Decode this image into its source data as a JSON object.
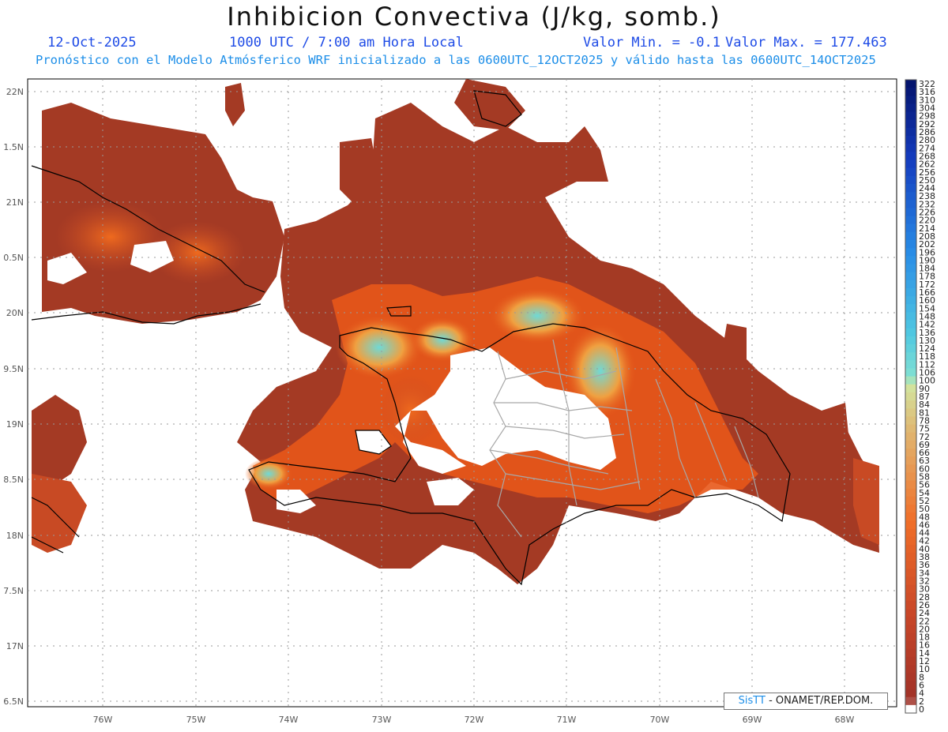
{
  "header": {
    "title": "Inhibicion Convectiva (J/kg, somb.)",
    "date": "12-Oct-2025",
    "time": "1000 UTC / 7:00 am Hora Local",
    "valor_min": "Valor Min. = -0.1",
    "valor_max": "Valor Max. = 177.463",
    "subtitle": "Pronóstico con el Modelo Atmósferico WRF inicializado a las 0600UTC_12OCT2025 y válido hasta las  0600UTC_14OCT2025"
  },
  "axes": {
    "lat_labels": [
      "22N",
      "1.5N",
      "21N",
      "0.5N",
      "20N",
      "9.5N",
      "19N",
      "8.5N",
      "18N",
      "7.5N",
      "17N",
      "6.5N"
    ],
    "lon_labels": [
      "76W",
      "75W",
      "74W",
      "73W",
      "72W",
      "71W",
      "70W",
      "69W",
      "68W"
    ]
  },
  "colorbar": {
    "labels": [
      "322",
      "316",
      "310",
      "304",
      "298",
      "292",
      "286",
      "280",
      "274",
      "268",
      "262",
      "256",
      "250",
      "244",
      "238",
      "232",
      "226",
      "220",
      "214",
      "208",
      "202",
      "196",
      "190",
      "184",
      "178",
      "172",
      "166",
      "160",
      "154",
      "148",
      "142",
      "136",
      "130",
      "124",
      "118",
      "112",
      "106",
      "100",
      "90",
      "87",
      "84",
      "81",
      "78",
      "75",
      "72",
      "69",
      "66",
      "63",
      "60",
      "58",
      "56",
      "54",
      "52",
      "50",
      "48",
      "46",
      "44",
      "42",
      "40",
      "38",
      "36",
      "34",
      "32",
      "30",
      "28",
      "26",
      "24",
      "22",
      "20",
      "18",
      "16",
      "14",
      "12",
      "10",
      "8",
      "6",
      "4",
      "2",
      "0"
    ]
  },
  "credit": {
    "brand": "SisTT",
    "text": "- ONAMET/REP.DOM."
  },
  "colors": {
    "title": "#111111",
    "info_blue": "#1e4be6",
    "subtitle_blue": "#1c8ee8",
    "field_low": "#a43a24",
    "field_mid": "#e8581a",
    "field_high": "#6fd9d6"
  }
}
